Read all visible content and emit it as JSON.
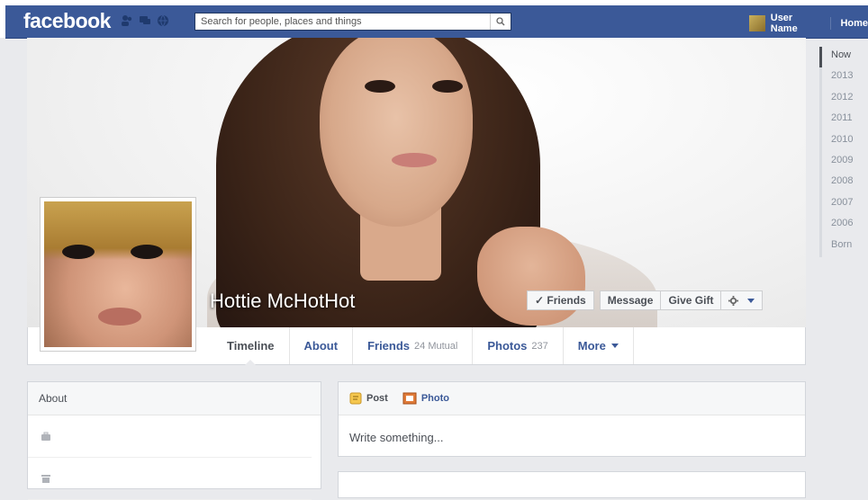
{
  "topbar": {
    "logo": "facebook",
    "search_placeholder": "Search for people, places and things",
    "user_name": "User Name",
    "home_label": "Home"
  },
  "profile": {
    "name": "Hottie McHotHot",
    "actions": {
      "friends_label": "✓ Friends",
      "message_label": "Message",
      "gift_label": "Give Gift"
    },
    "tabs": [
      {
        "label": "Timeline",
        "count": ""
      },
      {
        "label": "About",
        "count": ""
      },
      {
        "label": "Friends",
        "count": "24 Mutual"
      },
      {
        "label": "Photos",
        "count": "237"
      },
      {
        "label": "More",
        "count": ""
      }
    ]
  },
  "years": [
    "Now",
    "2013",
    "2012",
    "2011",
    "2010",
    "2009",
    "2008",
    "2007",
    "2006",
    "Born"
  ],
  "about": {
    "title": "About"
  },
  "composer": {
    "post_label": "Post",
    "photo_label": "Photo",
    "placeholder": "Write something..."
  },
  "colors": {
    "brand": "#3b5998",
    "background": "#e9eaed"
  }
}
